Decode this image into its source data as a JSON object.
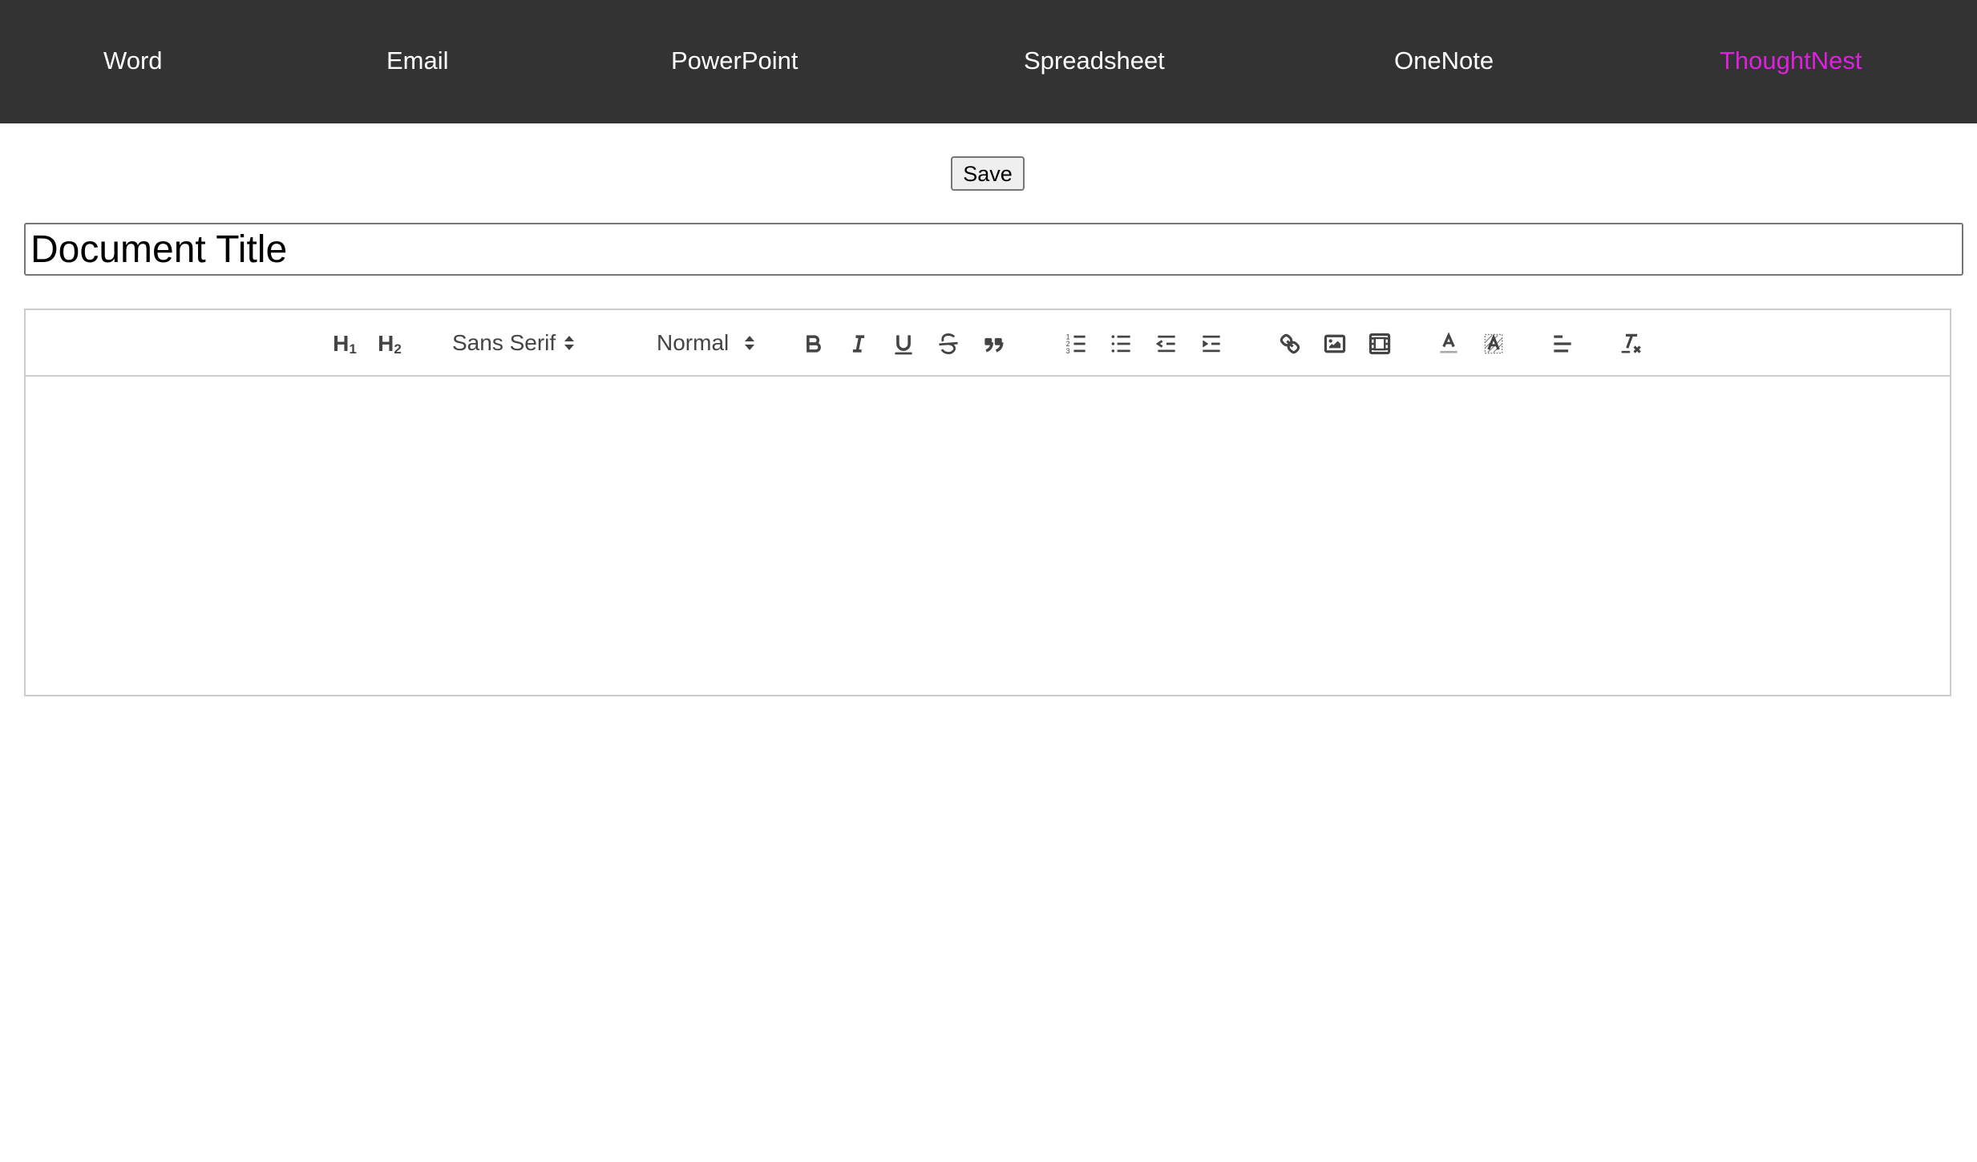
{
  "nav": {
    "items": [
      {
        "label": "Word",
        "active": false
      },
      {
        "label": "Email",
        "active": false
      },
      {
        "label": "PowerPoint",
        "active": false
      },
      {
        "label": "Spreadsheet",
        "active": false
      },
      {
        "label": "OneNote",
        "active": false
      },
      {
        "label": "ThoughtNest",
        "active": true
      }
    ],
    "background_color": "#333333",
    "text_color": "#ffffff",
    "active_color": "#e020e0"
  },
  "save_label": "Save",
  "title_input": {
    "value": "Document Title"
  },
  "toolbar": {
    "header1_label": "H",
    "header1_sub": "1",
    "header2_label": "H",
    "header2_sub": "2",
    "font_picker_value": "Sans Serif",
    "size_picker_value": "Normal",
    "icons": [
      "bold-icon",
      "italic-icon",
      "underline-icon",
      "strikethrough-icon",
      "blockquote-icon",
      "ordered-list-icon",
      "bullet-list-icon",
      "outdent-icon",
      "indent-icon",
      "link-icon",
      "image-icon",
      "video-icon",
      "text-color-icon",
      "background-color-icon",
      "align-left-icon",
      "clear-format-icon"
    ]
  },
  "editor": {
    "content": ""
  }
}
